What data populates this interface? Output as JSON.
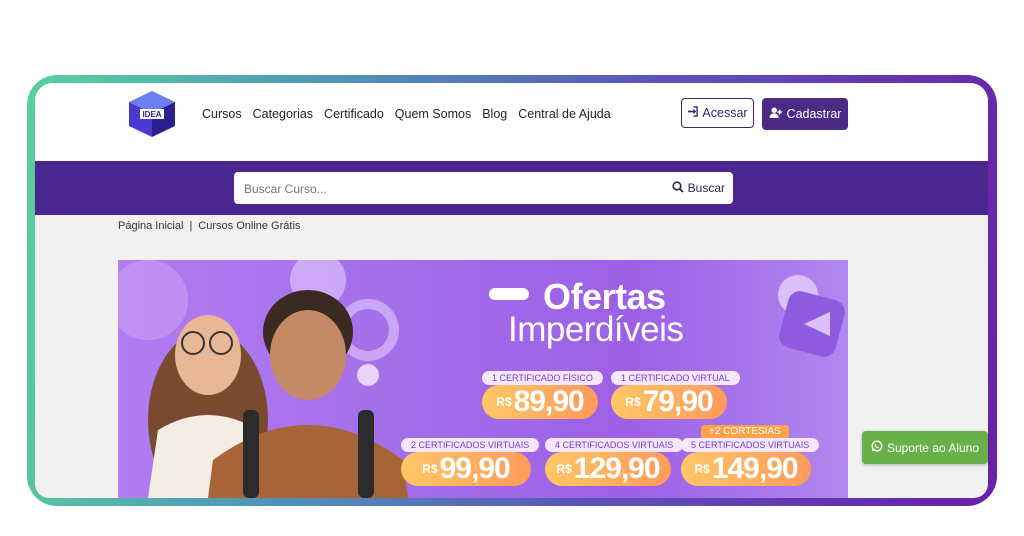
{
  "header": {
    "logo_text": "IDEA",
    "nav": [
      "Cursos",
      "Categorias",
      "Certificado",
      "Quem Somos",
      "Blog",
      "Central de Ajuda"
    ],
    "login_label": "Acessar",
    "signup_label": "Cadastrar"
  },
  "search": {
    "placeholder": "Buscar Curso...",
    "button_label": "Buscar"
  },
  "breadcrumb": {
    "home": "Página Inicial",
    "separator": "|",
    "current": "Cursos Online Grátis"
  },
  "banner": {
    "title_line1": "Ofertas",
    "title_line2": "Imperdíveis",
    "currency": "R$",
    "offers": [
      {
        "label": "1 CERTIFICADO FÍSICO",
        "price": "89,90"
      },
      {
        "label": "1 CERTIFICADO VIRTUAL",
        "price": "79,90"
      },
      {
        "label": "2 CERTIFICADOS VIRTUAIS",
        "price": "99,90"
      },
      {
        "label": "4 CERTIFICADOS VIRTUAIS",
        "price": "129,90"
      },
      {
        "label": "5 CERTIFICADOS VIRTUAIS",
        "price": "149,90"
      }
    ],
    "bonus_badge": "+2 CORTESIAS"
  },
  "support_button": "Suporte ao Aluno",
  "colors": {
    "brand_purple": "#4b2590",
    "accent_orange": "#ff9a5a",
    "support_green": "#68b14a"
  }
}
